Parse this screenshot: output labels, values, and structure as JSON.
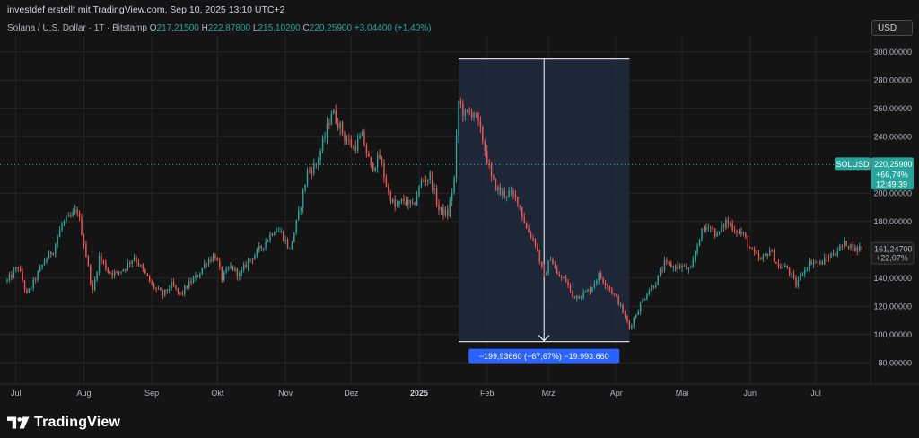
{
  "header": {
    "attribution": "investdef erstellt mit TradingView.com, Sep 10, 2025 13:10 UTC+2",
    "symbol_title": "Solana / U.S. Dollar · 1T · Bitstamp",
    "ohlc": [
      {
        "label": "O",
        "value": "217,21500"
      },
      {
        "label": "H",
        "value": "222,87800"
      },
      {
        "label": "L",
        "value": "215,10200"
      },
      {
        "label": "C",
        "value": "220,25900"
      }
    ],
    "change": "+3,04400 (+1,40%)",
    "currency_button": "USD"
  },
  "colors": {
    "up": "#26a69a",
    "down": "#ef5350",
    "background": "#141414",
    "measure_fill": "#1e2a3d",
    "measure_label_bg": "#2962ff",
    "price_badge": "#26a69a",
    "grid": "#262626"
  },
  "price_badges": {
    "current": {
      "symbol": "SOLUSD",
      "price": "220,25900",
      "change_pct": "+66,74%",
      "countdown": "12:49:39",
      "value": 220.259
    },
    "reference": {
      "price": "161,24700",
      "change_pct": "+22,07%",
      "value": 161.247
    }
  },
  "measure_tool": {
    "label": "−199,93660 (−67,67%) −19.993.660",
    "from_price": 295,
    "to_price": 95,
    "from_date": "2025-01-19",
    "to_date": "2025-04-07"
  },
  "logo": {
    "text": "TradingView",
    "icon": "tradingview-logo-icon"
  },
  "chart_data": {
    "type": "candlestick",
    "title": "Solana / U.S. Dollar · 1T · Bitstamp",
    "currency": "USD",
    "ylim": [
      70,
      310
    ],
    "y_ticks": [
      {
        "value": 300,
        "label": "300,00000"
      },
      {
        "value": 280,
        "label": "280,00000"
      },
      {
        "value": 260,
        "label": "260,00000"
      },
      {
        "value": 240,
        "label": "240,00000"
      },
      {
        "value": 200,
        "label": "200,00000"
      },
      {
        "value": 180,
        "label": "180,00000"
      },
      {
        "value": 140,
        "label": "140,00000"
      },
      {
        "value": 120,
        "label": "120,00000"
      },
      {
        "value": 100,
        "label": "100,00000"
      },
      {
        "value": 80,
        "label": "80,00000"
      }
    ],
    "x_range": [
      "2024-06-27",
      "2025-07-26"
    ],
    "x_ticks": [
      {
        "date": "2024-07-01",
        "label": "Jul",
        "bold": false
      },
      {
        "date": "2024-08-01",
        "label": "Aug",
        "bold": false
      },
      {
        "date": "2024-09-01",
        "label": "Sep",
        "bold": false
      },
      {
        "date": "2024-10-01",
        "label": "Okt",
        "bold": false
      },
      {
        "date": "2024-11-01",
        "label": "Nov",
        "bold": false
      },
      {
        "date": "2024-12-01",
        "label": "Dez",
        "bold": false
      },
      {
        "date": "2025-01-01",
        "label": "2025",
        "bold": true
      },
      {
        "date": "2025-02-01",
        "label": "Feb",
        "bold": false
      },
      {
        "date": "2025-03-01",
        "label": "Mrz",
        "bold": false
      },
      {
        "date": "2025-04-01",
        "label": "Apr",
        "bold": false
      },
      {
        "date": "2025-05-01",
        "label": "Mai",
        "bold": false
      },
      {
        "date": "2025-06-01",
        "label": "Jun",
        "bold": false
      },
      {
        "date": "2025-07-01",
        "label": "Jul",
        "bold": false
      }
    ],
    "price_path": [
      [
        "2024-06-27",
        138
      ],
      [
        "2024-07-02",
        148
      ],
      [
        "2024-07-06",
        128
      ],
      [
        "2024-07-10",
        140
      ],
      [
        "2024-07-14",
        152
      ],
      [
        "2024-07-18",
        160
      ],
      [
        "2024-07-22",
        178
      ],
      [
        "2024-07-26",
        183
      ],
      [
        "2024-07-29",
        188
      ],
      [
        "2024-08-01",
        165
      ],
      [
        "2024-08-05",
        130
      ],
      [
        "2024-08-08",
        155
      ],
      [
        "2024-08-12",
        145
      ],
      [
        "2024-08-16",
        143
      ],
      [
        "2024-08-20",
        148
      ],
      [
        "2024-08-24",
        155
      ],
      [
        "2024-08-28",
        145
      ],
      [
        "2024-09-01",
        135
      ],
      [
        "2024-09-06",
        128
      ],
      [
        "2024-09-10",
        135
      ],
      [
        "2024-09-14",
        128
      ],
      [
        "2024-09-18",
        136
      ],
      [
        "2024-09-22",
        142
      ],
      [
        "2024-09-26",
        152
      ],
      [
        "2024-09-30",
        156
      ],
      [
        "2024-10-03",
        140
      ],
      [
        "2024-10-07",
        148
      ],
      [
        "2024-10-11",
        142
      ],
      [
        "2024-10-15",
        152
      ],
      [
        "2024-10-19",
        158
      ],
      [
        "2024-10-23",
        166
      ],
      [
        "2024-10-27",
        175
      ],
      [
        "2024-10-30",
        172
      ],
      [
        "2024-11-03",
        160
      ],
      [
        "2024-11-07",
        185
      ],
      [
        "2024-11-11",
        215
      ],
      [
        "2024-11-15",
        220
      ],
      [
        "2024-11-19",
        240
      ],
      [
        "2024-11-22",
        258
      ],
      [
        "2024-11-25",
        250
      ],
      [
        "2024-11-28",
        240
      ],
      [
        "2024-12-02",
        232
      ],
      [
        "2024-12-06",
        240
      ],
      [
        "2024-12-10",
        218
      ],
      [
        "2024-12-14",
        225
      ],
      [
        "2024-12-18",
        200
      ],
      [
        "2024-12-21",
        190
      ],
      [
        "2024-12-25",
        195
      ],
      [
        "2024-12-29",
        190
      ],
      [
        "2025-01-02",
        208
      ],
      [
        "2025-01-06",
        212
      ],
      [
        "2025-01-10",
        188
      ],
      [
        "2025-01-14",
        185
      ],
      [
        "2025-01-17",
        210
      ],
      [
        "2025-01-19",
        265
      ],
      [
        "2025-01-22",
        255
      ],
      [
        "2025-01-26",
        258
      ],
      [
        "2025-01-30",
        238
      ],
      [
        "2025-02-03",
        210
      ],
      [
        "2025-02-07",
        200
      ],
      [
        "2025-02-11",
        200
      ],
      [
        "2025-02-15",
        195
      ],
      [
        "2025-02-19",
        175
      ],
      [
        "2025-02-23",
        165
      ],
      [
        "2025-02-27",
        140
      ],
      [
        "2025-03-02",
        155
      ],
      [
        "2025-03-05",
        142
      ],
      [
        "2025-03-09",
        138
      ],
      [
        "2025-03-12",
        127
      ],
      [
        "2025-03-16",
        128
      ],
      [
        "2025-03-20",
        132
      ],
      [
        "2025-03-24",
        142
      ],
      [
        "2025-03-28",
        135
      ],
      [
        "2025-04-02",
        123
      ],
      [
        "2025-04-07",
        105
      ],
      [
        "2025-04-11",
        118
      ],
      [
        "2025-04-15",
        130
      ],
      [
        "2025-04-19",
        137
      ],
      [
        "2025-04-23",
        150
      ],
      [
        "2025-04-27",
        148
      ],
      [
        "2025-05-01",
        148
      ],
      [
        "2025-05-05",
        145
      ],
      [
        "2025-05-09",
        170
      ],
      [
        "2025-05-13",
        178
      ],
      [
        "2025-05-17",
        170
      ],
      [
        "2025-05-21",
        180
      ],
      [
        "2025-05-25",
        175
      ],
      [
        "2025-05-29",
        170
      ],
      [
        "2025-06-02",
        158
      ],
      [
        "2025-06-06",
        152
      ],
      [
        "2025-06-10",
        160
      ],
      [
        "2025-06-14",
        148
      ],
      [
        "2025-06-18",
        147
      ],
      [
        "2025-06-22",
        135
      ],
      [
        "2025-06-25",
        145
      ],
      [
        "2025-06-29",
        152
      ],
      [
        "2025-07-03",
        150
      ],
      [
        "2025-07-07",
        155
      ],
      [
        "2025-07-11",
        160
      ],
      [
        "2025-07-15",
        165
      ],
      [
        "2025-07-19",
        160
      ],
      [
        "2025-07-22",
        162
      ]
    ]
  }
}
